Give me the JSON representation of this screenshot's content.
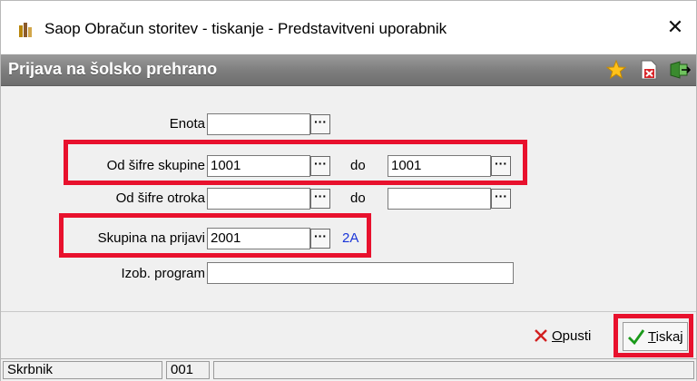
{
  "window": {
    "title": "Saop Obračun storitev - tiskanje - Predstavitveni uporabnik",
    "close_glyph": "✕",
    "app_icon": "saop-app-icon"
  },
  "header": {
    "title": "Prijava na šolsko prehrano",
    "icons": [
      "star-icon",
      "close-document-icon",
      "exit-icon"
    ]
  },
  "form": {
    "enota": {
      "label": "Enota",
      "value": ""
    },
    "od_sifre_skupine": {
      "label": "Od šifre skupine",
      "value": "1001",
      "do_label": "do",
      "do_value": "1001"
    },
    "od_sifre_otroka": {
      "label": "Od šifre otroka",
      "value": "",
      "do_label": "do",
      "do_value": ""
    },
    "skupina_na_prijavi": {
      "label": "Skupina na prijavi",
      "value": "2001",
      "resolved": "2A"
    },
    "izob_program": {
      "label": "Izob. program",
      "value": ""
    },
    "lookup_glyph": "···"
  },
  "buttons": {
    "cancel": {
      "first": "O",
      "rest": "pusti"
    },
    "print": {
      "first": "T",
      "rest": "iskaj"
    }
  },
  "status": {
    "cell1": "Skrbnik",
    "cell2": "001",
    "cell3": ""
  },
  "colors": {
    "highlight": "#e8112d",
    "link": "#1a35d8",
    "header_bar": "#7f7f7f"
  }
}
